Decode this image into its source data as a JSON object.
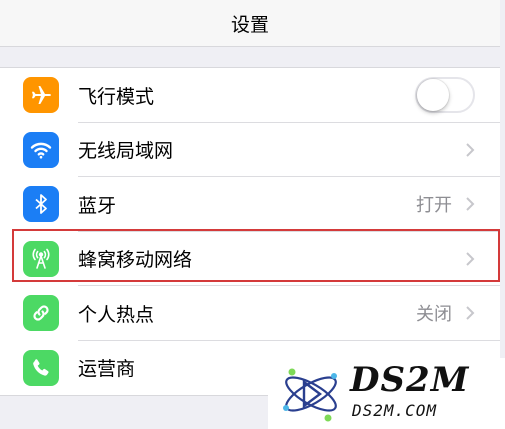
{
  "nav": {
    "title": "设置"
  },
  "rows": [
    {
      "label": "飞行模式",
      "icon": "airplane-icon",
      "color": "#ff9500",
      "control": "toggle",
      "toggle_on": false
    },
    {
      "label": "无线局域网",
      "icon": "wifi-icon",
      "color": "#1b7ef5",
      "control": "chevron"
    },
    {
      "label": "蓝牙",
      "icon": "bluetooth-icon",
      "color": "#1b7ef5",
      "value": "打开",
      "control": "chevron"
    },
    {
      "label": "蜂窝移动网络",
      "icon": "cellular-antenna-icon",
      "color": "#4cd964",
      "control": "chevron",
      "highlighted": true
    },
    {
      "label": "个人热点",
      "icon": "hotspot-link-icon",
      "color": "#4cd964",
      "value": "关闭",
      "control": "chevron"
    },
    {
      "label": "运营商",
      "icon": "phone-icon",
      "color": "#4cd964",
      "control": "chevron"
    }
  ],
  "watermark": {
    "brand": "DS2M",
    "url": "DS2M.COM"
  },
  "colors": {
    "highlight": "#d43a3a",
    "background": "#efeff4"
  }
}
